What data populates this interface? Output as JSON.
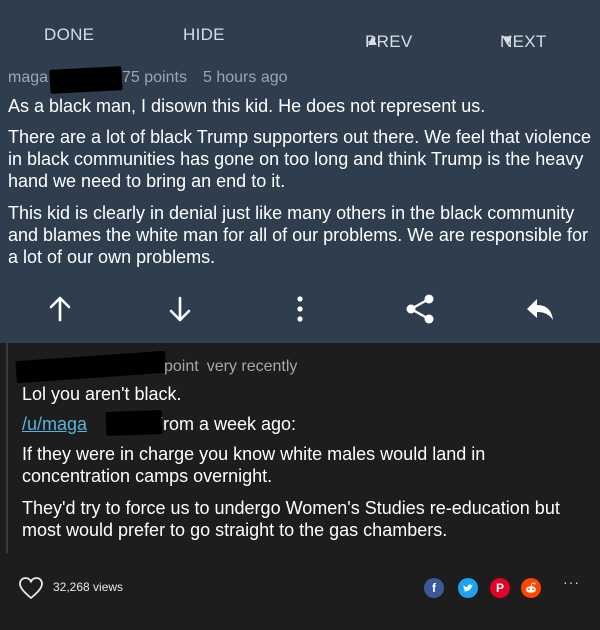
{
  "nav": {
    "done": "DONE",
    "hide": "HIDE",
    "prev": "PREV",
    "next": "NEXT"
  },
  "comment": {
    "user_visible": "maga",
    "points": "75 points",
    "age": "5 hours ago",
    "paragraphs": [
      "As a black man, I disown this kid. He does not represent us.",
      "There are a lot of black Trump supporters out there. We feel that violence in black communities has gone on too long and think Trump is the heavy hand we need to bring an end to it.",
      "This kid is clearly in denial just like many others in the black community and blames the white man for all of our problems. We are responsible for a lot of our own problems."
    ]
  },
  "actions": {
    "icons": [
      "arrow-up-icon",
      "arrow-down-icon",
      "more-vertical-icon",
      "share-icon",
      "reply-icon"
    ]
  },
  "reply": {
    "points": "point",
    "age": "very recently",
    "line1": "Lol you aren't black.",
    "link": "/u/maga",
    "from": "From a week ago:",
    "quote1": "If they were in charge you know white males would land in concentration camps overnight.",
    "quote2": "They'd try to force us to undergo Women's Studies re-education but most would prefer to go straight to the gas chambers."
  },
  "footer": {
    "views": "32,268 views",
    "social": [
      "f",
      "t",
      "P",
      "r"
    ],
    "more": "···"
  }
}
